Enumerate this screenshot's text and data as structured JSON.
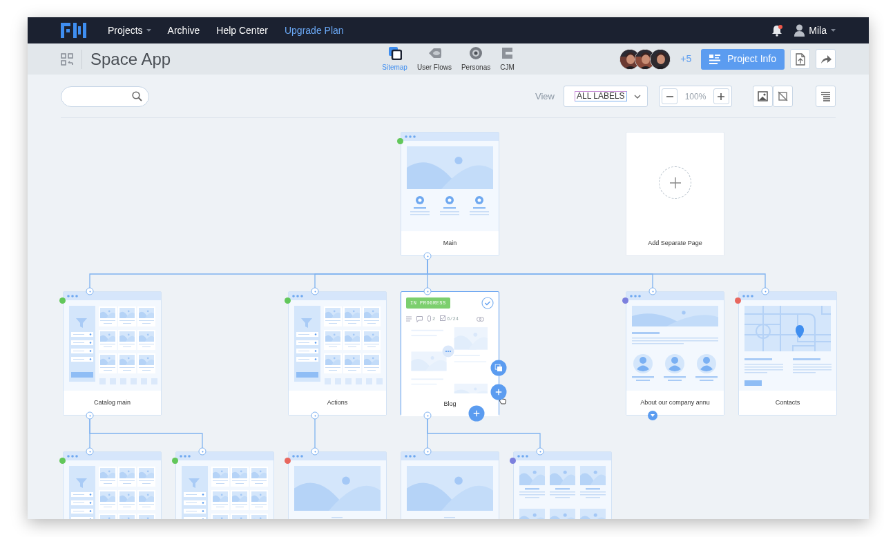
{
  "nav": {
    "menu": [
      {
        "label": "Projects",
        "kind": "dropdown"
      },
      {
        "label": "Archive",
        "kind": "link"
      },
      {
        "label": "Help Center",
        "kind": "link"
      },
      {
        "label": "Upgrade Plan",
        "kind": "highlight"
      }
    ],
    "notifications": {
      "unread": true
    },
    "user": {
      "name": "Mila"
    }
  },
  "header": {
    "title": "Space App",
    "views": [
      {
        "label": "Sitemap",
        "kind": "sitemap",
        "selected": true
      },
      {
        "label": "User Flows",
        "kind": "flows",
        "selected": false
      },
      {
        "label": "Personas",
        "kind": "personas",
        "selected": false
      },
      {
        "label": "CJM",
        "kind": "cjm",
        "selected": false
      }
    ],
    "collaborators": {
      "more": "+5"
    },
    "project_info": "Project Info"
  },
  "toolbar": {
    "view_label": "View",
    "view_value": "ALL LABELS",
    "zoom": "100%"
  },
  "sitemap": {
    "root": {
      "label": "Main",
      "color": "#62c75a",
      "kind": "hero-icons",
      "selected": false,
      "collapsed": false,
      "children": [
        {
          "label": "Catalog main",
          "color": "#62c75a",
          "kind": "catalog",
          "selected": false,
          "collapsed": false,
          "children": [
            {
              "color": "#62c75a",
              "kind": "catalog",
              "selected": false
            },
            {
              "color": "#62c75a",
              "kind": "catalog",
              "selected": false
            }
          ]
        },
        {
          "label": "Actions",
          "color": "#62c75a",
          "kind": "catalog",
          "selected": false,
          "collapsed": false,
          "children": [
            {
              "color": "#e8675e",
              "kind": "hero",
              "selected": false
            }
          ]
        },
        {
          "label": "Blog",
          "kind": "blog",
          "selected": true,
          "collapsed": false,
          "progress": "IN PROGRESS",
          "done": true,
          "attachments": "2",
          "tasks": "6/24",
          "children": [
            {
              "kind": "hero",
              "selected": false
            },
            {
              "color": "#7c80de",
              "kind": "gallery",
              "selected": false
            }
          ]
        },
        {
          "label": "About our company annu",
          "color": "#7c80de",
          "kind": "about",
          "selected": false,
          "collapsed": true
        },
        {
          "label": "Contacts",
          "color": "#e8675e",
          "kind": "map",
          "selected": false,
          "collapsed": false
        }
      ]
    }
  },
  "separate_page": {
    "label": "Add Separate Page"
  }
}
